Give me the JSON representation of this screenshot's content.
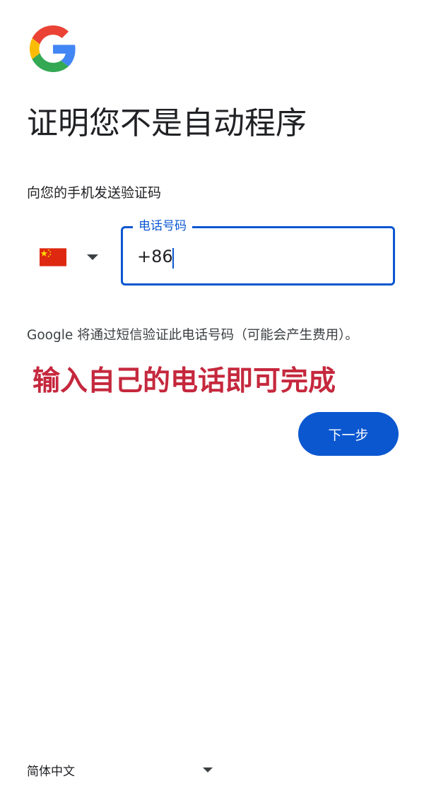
{
  "header": {
    "logo_icon": "google-g-logo",
    "title": "证明您不是自动程序",
    "subtitle": "向您的手机发送验证码"
  },
  "phone_entry": {
    "country_flag_icon": "china-flag-icon",
    "country_caret_icon": "caret-down-icon",
    "label": "电话号码",
    "value": "+86"
  },
  "notice": "Google 将通过短信验证此电话号码（可能会产生费用）。",
  "annotation": "输入自己的电话即可完成",
  "next_button_label": "下一步",
  "footer": {
    "language_label": "简体中文",
    "language_caret_icon": "caret-down-icon"
  },
  "colors": {
    "accent": "#0b57d0",
    "annotation": "#c5283d",
    "text": "#202124",
    "background": "#ffffff"
  }
}
